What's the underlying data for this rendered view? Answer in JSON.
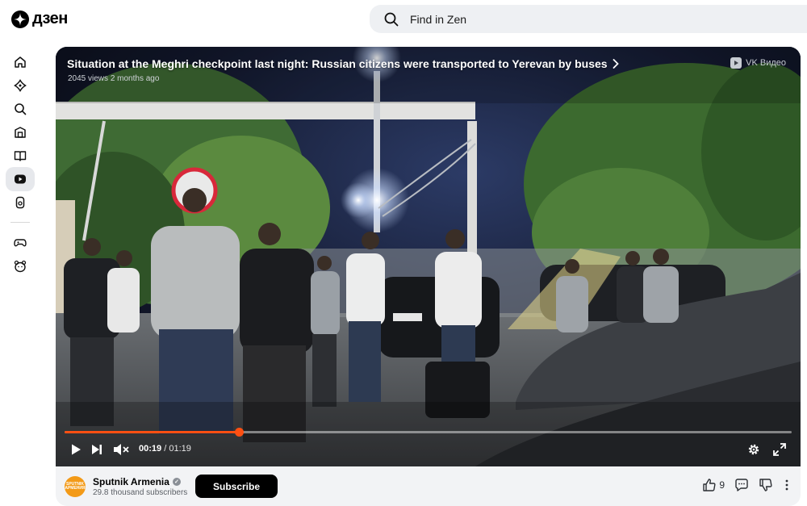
{
  "app": {
    "logo_text": "дзен"
  },
  "search": {
    "placeholder": "Find in Zen"
  },
  "sidebar": {
    "items": [
      {
        "icon": "home-icon"
      },
      {
        "icon": "puzzle-icon"
      },
      {
        "icon": "search-icon"
      },
      {
        "icon": "subscriptions-icon"
      },
      {
        "icon": "articles-icon"
      },
      {
        "icon": "video-icon",
        "active": true
      },
      {
        "icon": "shorts-icon"
      },
      {
        "icon": "games-icon"
      },
      {
        "icon": "kids-icon"
      }
    ]
  },
  "video": {
    "title": "Situation at the Meghri checkpoint last night: Russian citizens were transported to Yerevan by buses",
    "views": "2045 views",
    "age": "2 months ago",
    "source_badge": "VK Видео",
    "current_time": "00:19",
    "time_separator": "/",
    "duration": "01:19",
    "progress_fraction": 0.24
  },
  "channel": {
    "name": "Sputnik Armenia",
    "subscribers": "29.8 thousand subscribers",
    "subscribe_label": "Subscribe",
    "avatar_text": "SPUTNIK АРМЕНИЯ"
  },
  "actions": {
    "likes": "9"
  },
  "colors": {
    "accent": "#ff4f12",
    "button_dark": "#000000",
    "search_bg": "#eef0f3"
  }
}
